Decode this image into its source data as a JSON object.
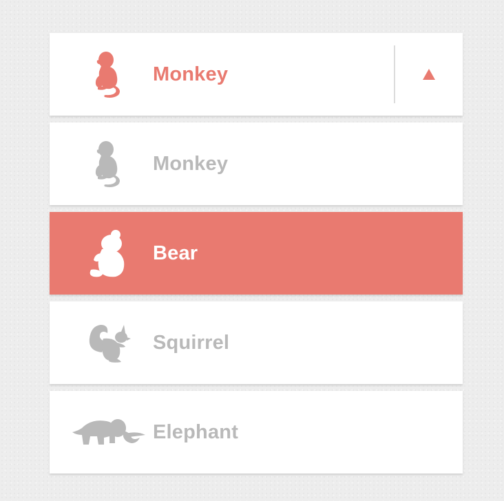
{
  "colors": {
    "accent": "#e97a70",
    "muted": "#b9b9b9",
    "background": "#ededed",
    "card": "#ffffff"
  },
  "dropdown": {
    "selected_label": "Monkey",
    "selected_icon": "monkey-icon",
    "toggle_icon": "triangle-up-icon",
    "options": [
      {
        "label": "Monkey",
        "icon": "monkey-icon",
        "highlighted": false
      },
      {
        "label": "Bear",
        "icon": "bear-icon",
        "highlighted": true
      },
      {
        "label": "Squirrel",
        "icon": "squirrel-icon",
        "highlighted": false
      },
      {
        "label": "Elephant",
        "icon": "elephant-icon",
        "highlighted": false
      }
    ]
  }
}
